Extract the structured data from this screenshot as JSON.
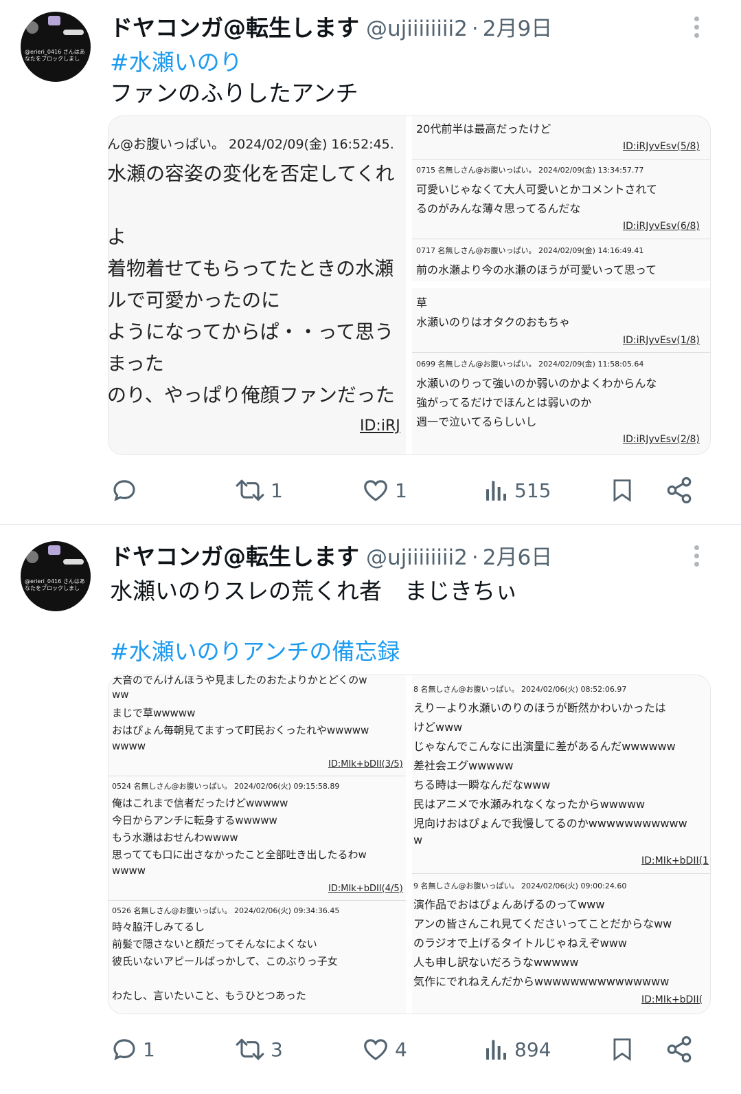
{
  "tweets": [
    {
      "author_name": "ドヤコンガ@転生します",
      "handle": "@ujiiiiiiii2",
      "separator": "·",
      "date": "2月9日",
      "avatar_text": [
        "@erieri_0416 さんはあ",
        "なたをブロックしまし"
      ],
      "text_lines": [
        "#水瀬いのり",
        "ファンのふりしたアンチ"
      ],
      "left_image": {
        "lines": [
          "ん@お腹いっぱい。 2024/02/09(金) 16:52:45.",
          "水瀬の容姿の変化を否定してくれ",
          "よ",
          "着物着せてもらってたときの水瀬",
          "ルで可愛かったのに",
          "ようになってからぱ・・って思う",
          "まった",
          "のり、やっぱり俺顔ファンだった",
          "ID:iRJ"
        ]
      },
      "right_image": {
        "lines": [
          "20代前半は最高だったけど",
          "ID:iRJyvEsv(5/8)",
          "0715 名無しさん@お腹いっぱい。 2024/02/09(金) 13:34:57.77",
          "可愛いじゃなくて大人可愛いとかコメントされて",
          "るのがみんな薄々思ってるんだな",
          "ID:iRJyvEsv(6/8)",
          "0717 名無しさん@お腹いっぱい。 2024/02/09(金) 14:16:49.41",
          "前の水瀬より今の水瀬のほうが可愛いって思って",
          "草",
          "水瀬いのりはオタクのおもちゃ",
          "ID:iRJyvEsv(1/8)",
          "0699 名無しさん@お腹いっぱい。 2024/02/09(金) 11:58:05.64",
          "水瀬いのりって強いのか弱いのかよくわからんな",
          "強がってるだけでほんとは弱いのか",
          "週一で泣いてるらしいし",
          "ID:iRJyvEsv(2/8)"
        ]
      },
      "actions": {
        "reply": "",
        "retweet": "1",
        "like": "1",
        "views": "515"
      }
    },
    {
      "author_name": "ドヤコンガ@転生します",
      "handle": "@ujiiiiiiii2",
      "separator": "·",
      "date": "2月6日",
      "avatar_text": [
        "@erieri_0416 さんはあ",
        "なたをブロックしまし"
      ],
      "text_lines": [
        "水瀬いのりスレの荒くれ者　まじきちぃ",
        "#水瀬いのりアンチの備忘録"
      ],
      "left_image": {
        "lines": [
          "大音のでんけんほうや見ましたのおたよりかとどくのw",
          "ww",
          "まじで草wwwww",
          "おはぴょん毎朝見てますって町民おくったれやwwwww",
          "wwww",
          "ID:MIk+bDII(3/5)",
          "0524 名無しさん@お腹いっぱい。 2024/02/06(火) 09:15:58.89",
          "俺はこれまで信者だったけどwwwww",
          "今日からアンチに転身するwwwww",
          "もう水瀬はおせんわwwww",
          "思ってても口に出さなかったこと全部吐き出したるわw",
          "wwww",
          "ID:MIk+bDII(4/5)",
          "0526 名無しさん@お腹いっぱい。 2024/02/06(火) 09:34:36.45",
          "時々脇汗しみてるし",
          "前髪で隠さないと顔だってそんなによくない",
          "彼氏いないアピールばっかして、このぶりっ子女",
          "わたし、言いたいこと、もうひとつあった"
        ]
      },
      "right_image": {
        "lines": [
          "8 名無しさん@お腹いっぱい。 2024/02/06(火) 08:52:06.97",
          "えりーより水瀬いのりのほうが断然かわいかったは",
          "けどwww",
          "じゃなんでこんなに出演量に差があるんだwwwwww",
          "差社会エグwwwww",
          "ちる時は一瞬なんだなwww",
          "民はアニメで水瀬みれなくなったからwwwww",
          "児向けおはぴょんで我慢してるのかwwwwwwwwwww",
          "w",
          "ID:MIk+bDII(1",
          "9 名無しさん@お腹いっぱい。 2024/02/06(火) 09:00:24.60",
          "演作品でおはぴょんあげるのってwww",
          "アンの皆さんこれ見てくださいってことだからなww",
          "のラジオで上げるタイトルじゃねえぞwww",
          "人も申し訳ないだろうなwwwww",
          "気作にでれねえんだからwwwwwwwwwwwwwww",
          "ID:MIk+bDII("
        ]
      },
      "actions": {
        "reply": "1",
        "retweet": "3",
        "like": "4",
        "views": "894"
      }
    }
  ],
  "icons": {
    "reply": "reply-icon",
    "retweet": "retweet-icon",
    "like": "heart-icon",
    "views": "views-icon",
    "bookmark": "bookmark-icon",
    "share": "share-icon",
    "more": "more-icon"
  },
  "colors": {
    "text": "#0f1419",
    "secondary": "#536471",
    "link": "#1d9bf0",
    "divider": "#e2e6ea"
  }
}
